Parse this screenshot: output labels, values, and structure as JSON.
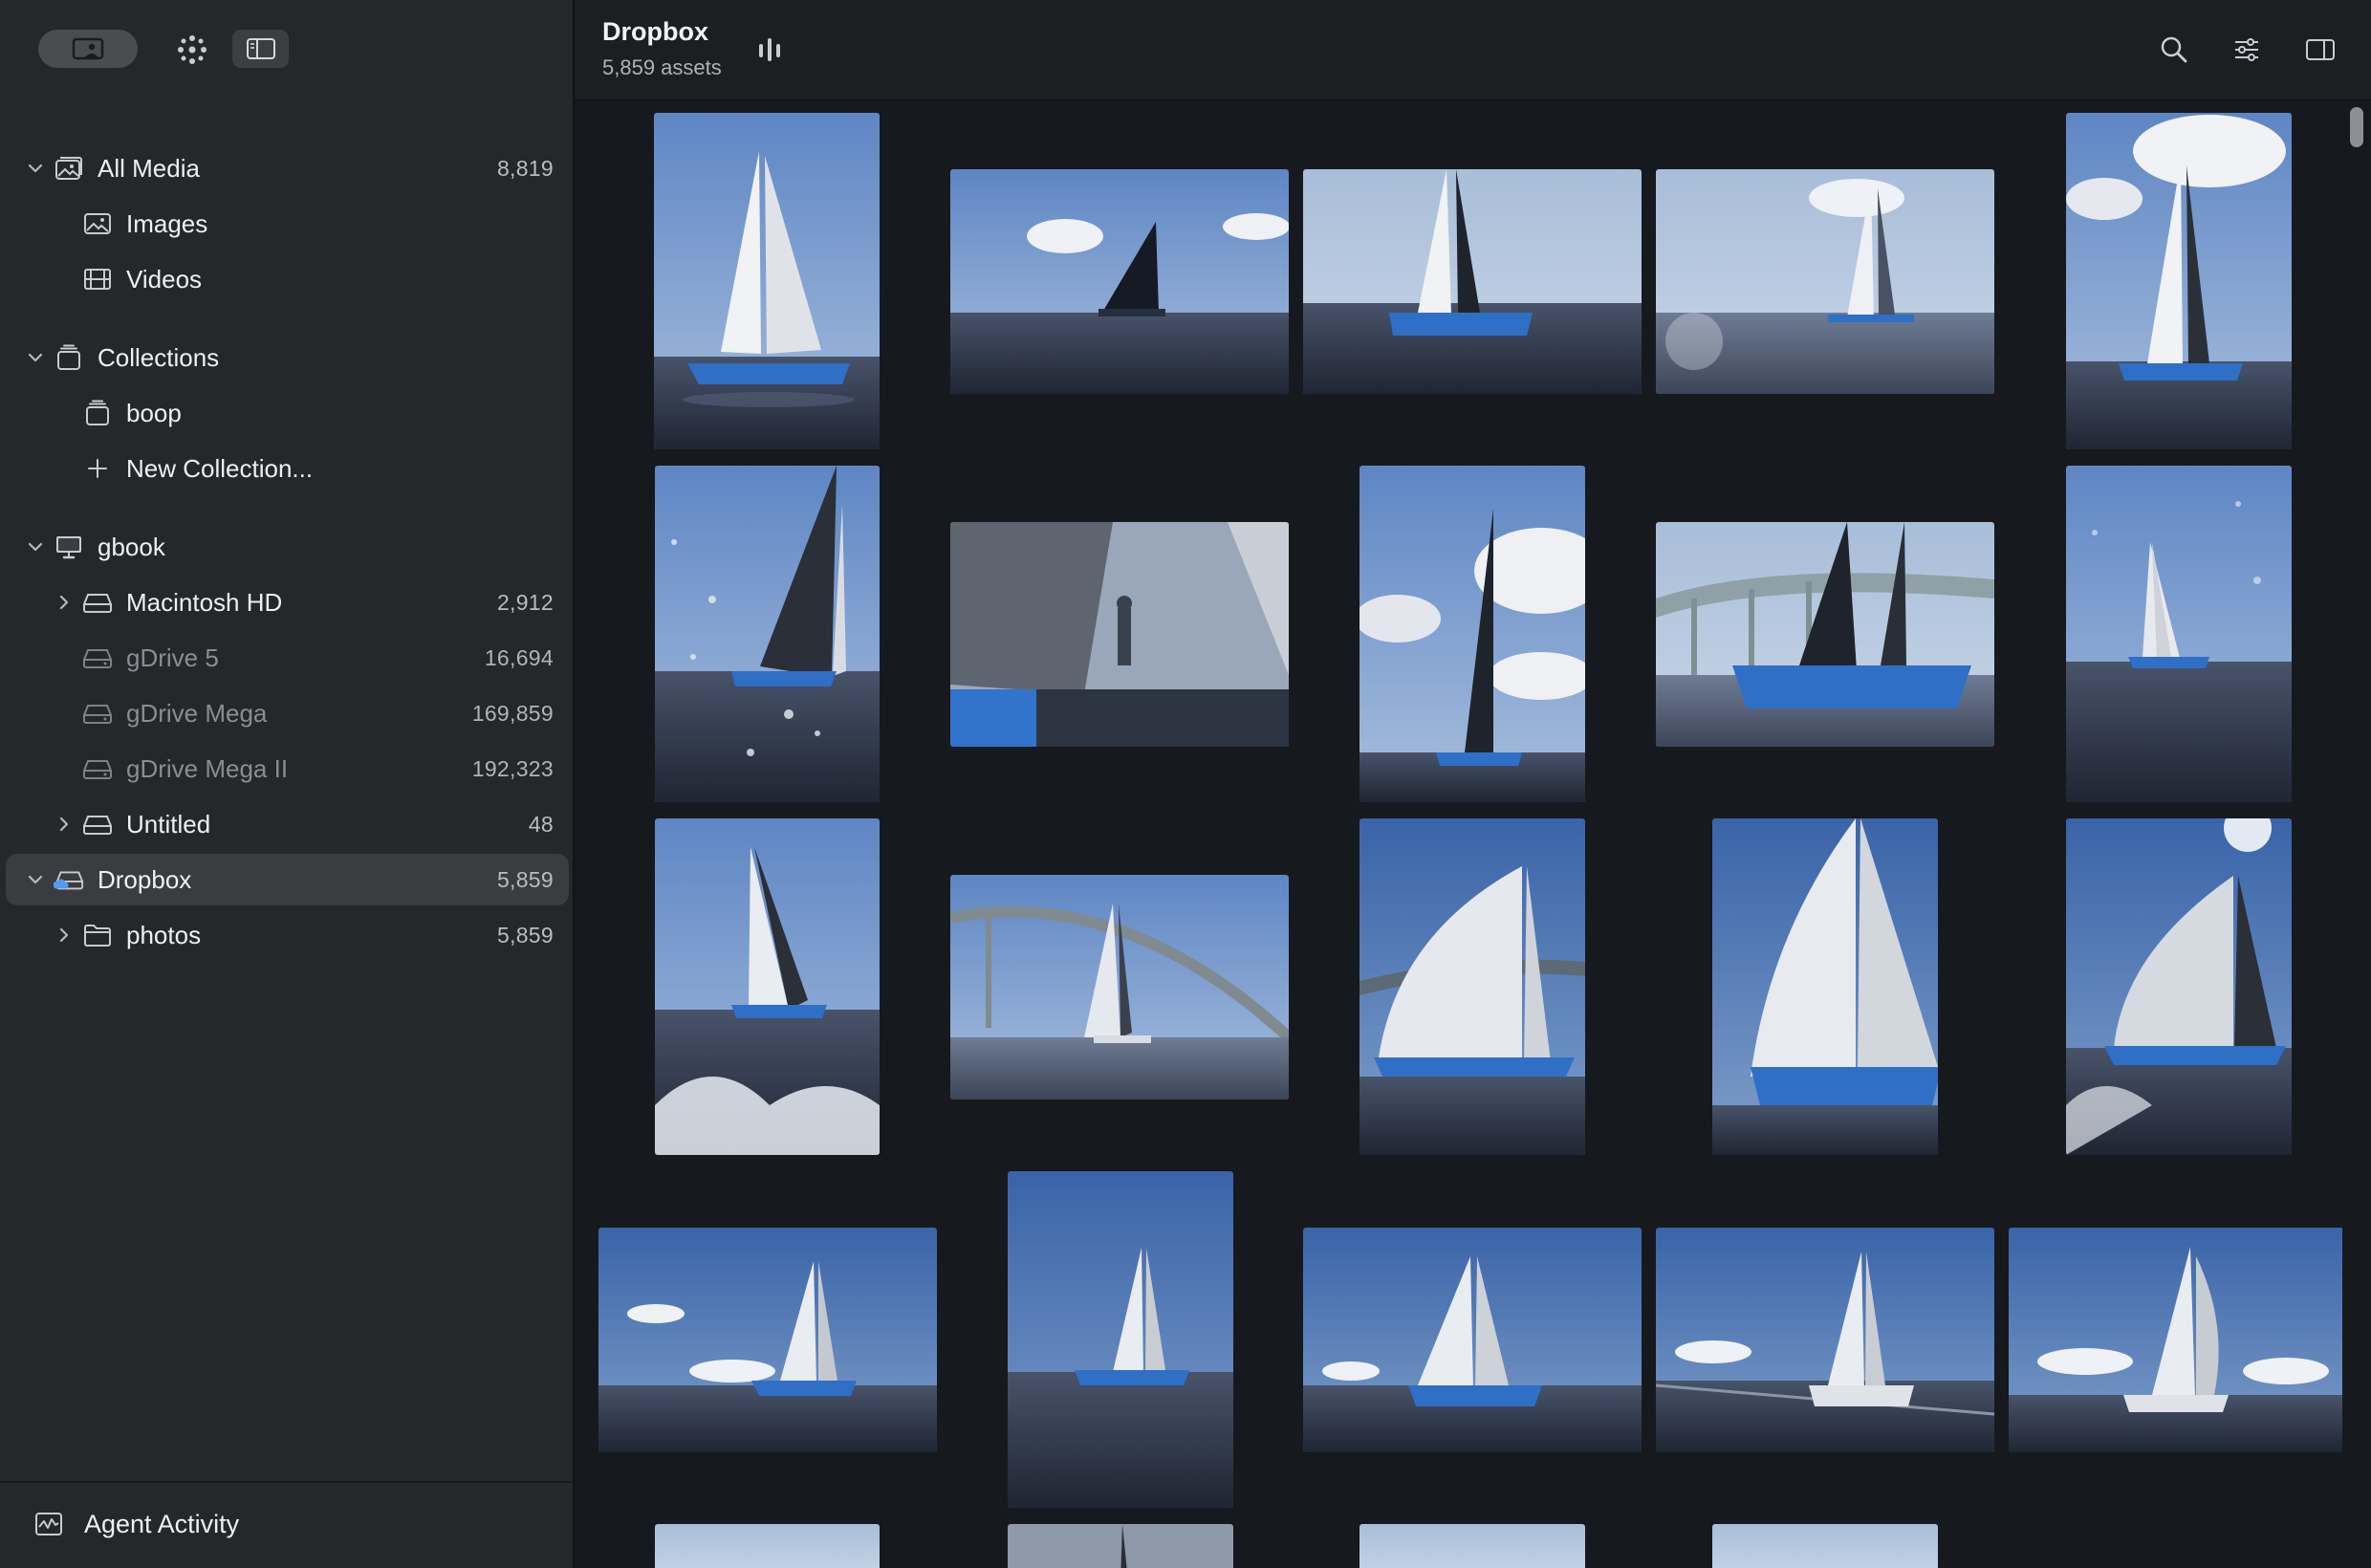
{
  "header": {
    "title": "Dropbox",
    "subtitle": "5,859 assets"
  },
  "sidebar": {
    "sections": [
      {
        "label": "All Media",
        "count": "8,819",
        "icon": "photo-library-icon",
        "expanded": true
      },
      {
        "label": "Images",
        "count": "",
        "icon": "image-icon"
      },
      {
        "label": "Videos",
        "count": "",
        "icon": "film-icon"
      },
      {
        "label": "Collections",
        "count": "",
        "icon": "collection-stack-icon",
        "expanded": true
      },
      {
        "label": "boop",
        "count": "",
        "icon": "collection-stack-icon"
      },
      {
        "label": "New Collection...",
        "count": "",
        "icon": "plus-icon"
      },
      {
        "label": "gbook",
        "count": "",
        "icon": "computer-icon",
        "expanded": true
      },
      {
        "label": "Macintosh HD",
        "count": "2,912",
        "icon": "drive-icon",
        "expanded": false
      },
      {
        "label": "gDrive 5",
        "count": "16,694",
        "icon": "offline-drive-icon",
        "offline": true
      },
      {
        "label": "gDrive Mega",
        "count": "169,859",
        "icon": "offline-drive-icon",
        "offline": true
      },
      {
        "label": "gDrive Mega II",
        "count": "192,323",
        "icon": "offline-drive-icon",
        "offline": true
      },
      {
        "label": "Untitled",
        "count": "48",
        "icon": "drive-icon",
        "expanded": false
      },
      {
        "label": "Dropbox",
        "count": "5,859",
        "icon": "cloud-drive-icon",
        "expanded": true,
        "selected": true
      },
      {
        "label": "photos",
        "count": "5,859",
        "icon": "folder-icon",
        "expanded": false
      }
    ],
    "footer": {
      "label": "Agent Activity",
      "icon": "activity-monitor-icon"
    }
  },
  "toolbar": {
    "icons": [
      "search-icon",
      "filter-sliders-icon",
      "inspector-panel-icon",
      "stats-bars-icon"
    ]
  },
  "colors": {
    "sidebar_bg": "#25272a",
    "content_bg": "#16191e",
    "selected_row": "#3a3c40",
    "text": "#eef0f2",
    "muted": "#8a8d92"
  }
}
